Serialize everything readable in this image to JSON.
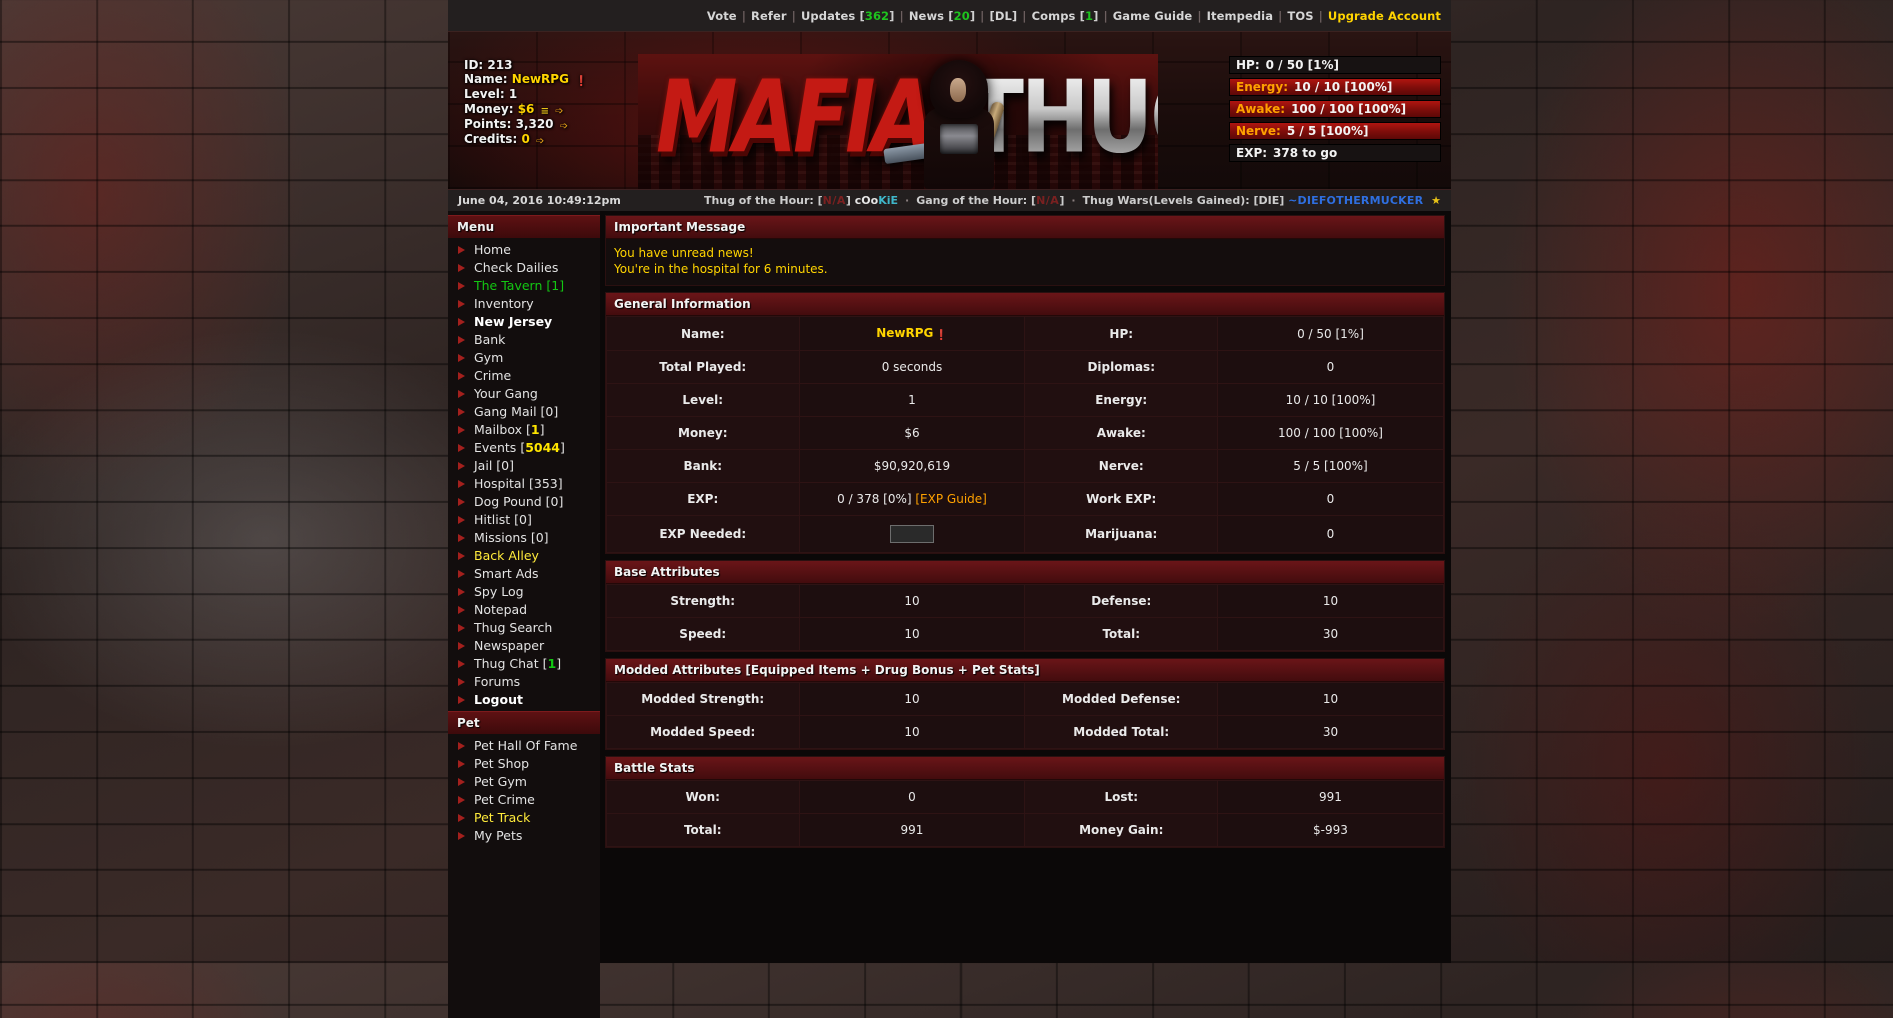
{
  "topnav": {
    "items": [
      {
        "label": "Vote",
        "type": "link"
      },
      {
        "label": "Refer",
        "type": "link"
      },
      {
        "label": "Updates",
        "type": "link",
        "count": "362",
        "count_color": "green"
      },
      {
        "label": "News",
        "type": "link",
        "count": "20",
        "count_color": "green"
      },
      {
        "label": "[DL]",
        "type": "link"
      },
      {
        "label": "Comps",
        "type": "link",
        "count": "1",
        "count_color": "green"
      },
      {
        "label": "Game Guide",
        "type": "link"
      },
      {
        "label": "Itempedia",
        "type": "link"
      },
      {
        "label": "TOS",
        "type": "link"
      },
      {
        "label": "Upgrade Account",
        "type": "link",
        "highlight": "#ffd400"
      }
    ]
  },
  "player": {
    "id_label": "ID:",
    "id_value": "213",
    "name_label": "Name:",
    "name_value": "NewRPG",
    "level_label": "Level:",
    "level_value": "1",
    "money_label": "Money:",
    "money_value": "$6",
    "points_label": "Points:",
    "points_value": "3,320",
    "credits_label": "Credits:",
    "credits_value": "0"
  },
  "logo": {
    "word1": "MAFIA",
    "word2": "THUG"
  },
  "statusbars": [
    {
      "label": "HP:",
      "value": "0 / 50 [1%]",
      "percent": 1,
      "style": "plain"
    },
    {
      "label": "Energy:",
      "value": "10 / 10 [100%]",
      "percent": 100,
      "style": "bar"
    },
    {
      "label": "Awake:",
      "value": "100 / 100 [100%]",
      "percent": 100,
      "style": "bar"
    },
    {
      "label": "Nerve:",
      "value": "5 / 5 [100%]",
      "percent": 100,
      "style": "bar"
    },
    {
      "label": "EXP:",
      "value": "378 to go",
      "percent": 0,
      "style": "plain"
    }
  ],
  "datebar": {
    "datetime": "June 04, 2016 10:49:12pm",
    "thug_of_hour_label": "Thug of the Hour:",
    "thug_of_hour_bracket_open": "[",
    "thug_of_hour_hidden": "N/A",
    "thug_of_hour_bracket_close": "]",
    "thug_of_hour_name_part1": "cOo",
    "thug_of_hour_name_part2": "KiE",
    "gang_of_hour_label": "Gang of the Hour:",
    "gang_of_hour_bracket_open": "[",
    "gang_of_hour_hidden": "N/A",
    "gang_of_hour_bracket_close": "]",
    "thug_wars_label": "Thug Wars(Levels Gained): [DIE]",
    "thug_wars_name": "~DIEFOTHERMUCKER",
    "star": "★",
    "dot": "·"
  },
  "sidebar": {
    "menu_title": "Menu",
    "menu_items": [
      {
        "label": "Home",
        "style": "normal"
      },
      {
        "label": "Check Dailies",
        "style": "normal"
      },
      {
        "label": "The Tavern",
        "style": "green",
        "count": "1",
        "count_style": "plain"
      },
      {
        "label": "Inventory",
        "style": "normal"
      },
      {
        "label": "New Jersey",
        "style": "bold"
      },
      {
        "label": "Bank",
        "style": "normal"
      },
      {
        "label": "Gym",
        "style": "normal"
      },
      {
        "label": "Crime",
        "style": "normal"
      },
      {
        "label": "Your Gang",
        "style": "normal"
      },
      {
        "label": "Gang Mail",
        "style": "normal",
        "count": "0",
        "count_style": "plain"
      },
      {
        "label": "Mailbox",
        "style": "normal",
        "count": "1",
        "count_style": "yellow"
      },
      {
        "label": "Events",
        "style": "normal",
        "count": "5044",
        "count_style": "yellow"
      },
      {
        "label": "Jail",
        "style": "normal",
        "count": "0",
        "count_style": "plain"
      },
      {
        "label": "Hospital",
        "style": "normal",
        "count": "353",
        "count_style": "plain"
      },
      {
        "label": "Dog Pound",
        "style": "normal",
        "count": "0",
        "count_style": "plain"
      },
      {
        "label": "Hitlist",
        "style": "normal",
        "count": "0",
        "count_style": "plain"
      },
      {
        "label": "Missions",
        "style": "normal",
        "count": "0",
        "count_style": "plain"
      },
      {
        "label": "Back Alley",
        "style": "yellow"
      },
      {
        "label": "Smart Ads",
        "style": "normal"
      },
      {
        "label": "Spy Log",
        "style": "normal"
      },
      {
        "label": "Notepad",
        "style": "normal"
      },
      {
        "label": "Thug Search",
        "style": "normal"
      },
      {
        "label": "Newspaper",
        "style": "normal"
      },
      {
        "label": "Thug Chat",
        "style": "normal",
        "count": "1",
        "count_style": "green"
      },
      {
        "label": "Forums",
        "style": "normal"
      },
      {
        "label": "Logout",
        "style": "bold"
      }
    ],
    "pet_title": "Pet",
    "pet_items": [
      {
        "label": "Pet Hall Of Fame",
        "style": "normal"
      },
      {
        "label": "Pet Shop",
        "style": "normal"
      },
      {
        "label": "Pet Gym",
        "style": "normal"
      },
      {
        "label": "Pet Crime",
        "style": "normal"
      },
      {
        "label": "Pet Track",
        "style": "yellow"
      },
      {
        "label": "My Pets",
        "style": "normal"
      }
    ]
  },
  "main": {
    "important_message": {
      "title": "Important Message",
      "lines": [
        "You have unread news!",
        "You're in the hospital for 6 minutes."
      ]
    },
    "general_information": {
      "title": "General Information",
      "rows": [
        {
          "label1": "Name:",
          "value1": "NewRPG",
          "value1_style": "yellow-name",
          "label2": "HP:",
          "value2": "0 / 50 [1%]"
        },
        {
          "label1": "Total Played:",
          "value1": "0 seconds",
          "label2": "Diplomas:",
          "value2": "0"
        },
        {
          "label1": "Level:",
          "value1": "1",
          "label2": "Energy:",
          "value2": "10 / 10 [100%]"
        },
        {
          "label1": "Money:",
          "value1": "$6",
          "label2": "Awake:",
          "value2": "100 / 100 [100%]"
        },
        {
          "label1": "Bank:",
          "value1": "$90,920,619",
          "label2": "Nerve:",
          "value2": "5 / 5 [100%]"
        },
        {
          "label1": "EXP:",
          "value1": "0 / 378 [0%]",
          "value1_link": "[EXP Guide]",
          "value1_style": "exp",
          "label2": "Work EXP:",
          "value2": "0"
        },
        {
          "label1": "EXP Needed:",
          "value1": "",
          "value1_style": "input",
          "label2": "Marijuana:",
          "value2": "0"
        }
      ]
    },
    "base_attributes": {
      "title": "Base Attributes",
      "rows": [
        {
          "label1": "Strength:",
          "value1": "10",
          "label2": "Defense:",
          "value2": "10"
        },
        {
          "label1": "Speed:",
          "value1": "10",
          "label2": "Total:",
          "value2": "30"
        }
      ]
    },
    "modded_attributes": {
      "title": "Modded Attributes [Equipped Items + Drug Bonus + Pet Stats]",
      "rows": [
        {
          "label1": "Modded Strength:",
          "value1": "10",
          "label2": "Modded Defense:",
          "value2": "10"
        },
        {
          "label1": "Modded Speed:",
          "value1": "10",
          "label2": "Modded Total:",
          "value2": "30"
        }
      ]
    },
    "battle_stats": {
      "title": "Battle Stats",
      "rows": [
        {
          "label1": "Won:",
          "value1": "0",
          "label2": "Lost:",
          "value2": "991"
        },
        {
          "label1": "Total:",
          "value1": "991",
          "label2": "Money Gain:",
          "value2": "$-993"
        }
      ]
    }
  },
  "colors": {
    "accent_red": "#6a1518",
    "accent_yellow": "#ffd400",
    "accent_green": "#13c713",
    "panel_bg": "#1b0e0f"
  }
}
